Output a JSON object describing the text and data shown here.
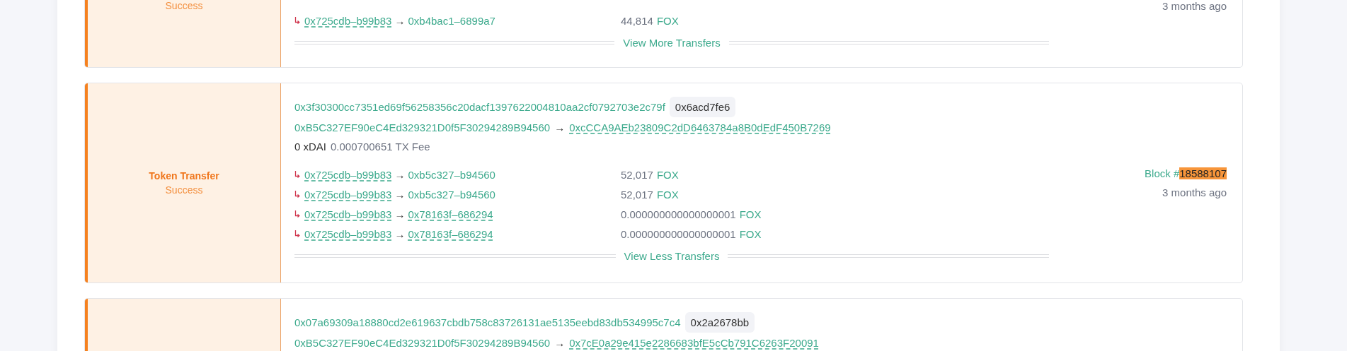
{
  "transactions": [
    {
      "status": "Success",
      "transfers": [
        {
          "from": "0x725cdb–b99b83",
          "to": "0xb4bac1–6899a7",
          "arrow": "→",
          "to_linked": false,
          "amount": "44,814",
          "token": "FOX"
        }
      ],
      "toggle": "View More Transfers",
      "time": "3 months ago"
    },
    {
      "type": "Token Transfer",
      "status": "Success",
      "hash": "0x3f30300cc7351ed69f56258356c20dacf1397622004810aa2cf0792703e2c79f",
      "nonce": "0x6acd7fe6",
      "from": "0xB5C327EF90eC4Ed329321D0f5F30294289B94560",
      "arrow": "→",
      "to": "0xcCCA9AEb23809C2dD6463784a8B0dEdF450B7269",
      "value": "0 xDAI",
      "fee": "0.000700651 TX Fee",
      "transfers": [
        {
          "from": "0x725cdb–b99b83",
          "arrow": "→",
          "to": "0xb5c327–b94560",
          "to_linked": false,
          "amount": "52,017",
          "token": "FOX"
        },
        {
          "from": "0x725cdb–b99b83",
          "arrow": "→",
          "to": "0xb5c327–b94560",
          "to_linked": false,
          "amount": "52,017",
          "token": "FOX"
        },
        {
          "from": "0x725cdb–b99b83",
          "arrow": "→",
          "to": "0x78163f–686294",
          "to_linked": true,
          "amount": "0.000000000000000001",
          "token": "FOX"
        },
        {
          "from": "0x725cdb–b99b83",
          "arrow": "→",
          "to": "0x78163f–686294",
          "to_linked": true,
          "amount": "0.000000000000000001",
          "token": "FOX"
        }
      ],
      "toggle": "View Less Transfers",
      "block_label": "Block #",
      "block": "18588107",
      "block_highlighted": true,
      "time": "3 months ago"
    },
    {
      "hash": "0x07a69309a18880cd2e619637cbdb758c83726131ae5135eebd83db534995c7c4",
      "nonce": "0x2a2678bb",
      "from": "0xB5C327EF90eC4Ed329321D0f5F30294289B94560",
      "arrow": "→",
      "to": "0x7cE0a29e415e2286683bfE5cCb791C6263F20091"
    }
  ]
}
